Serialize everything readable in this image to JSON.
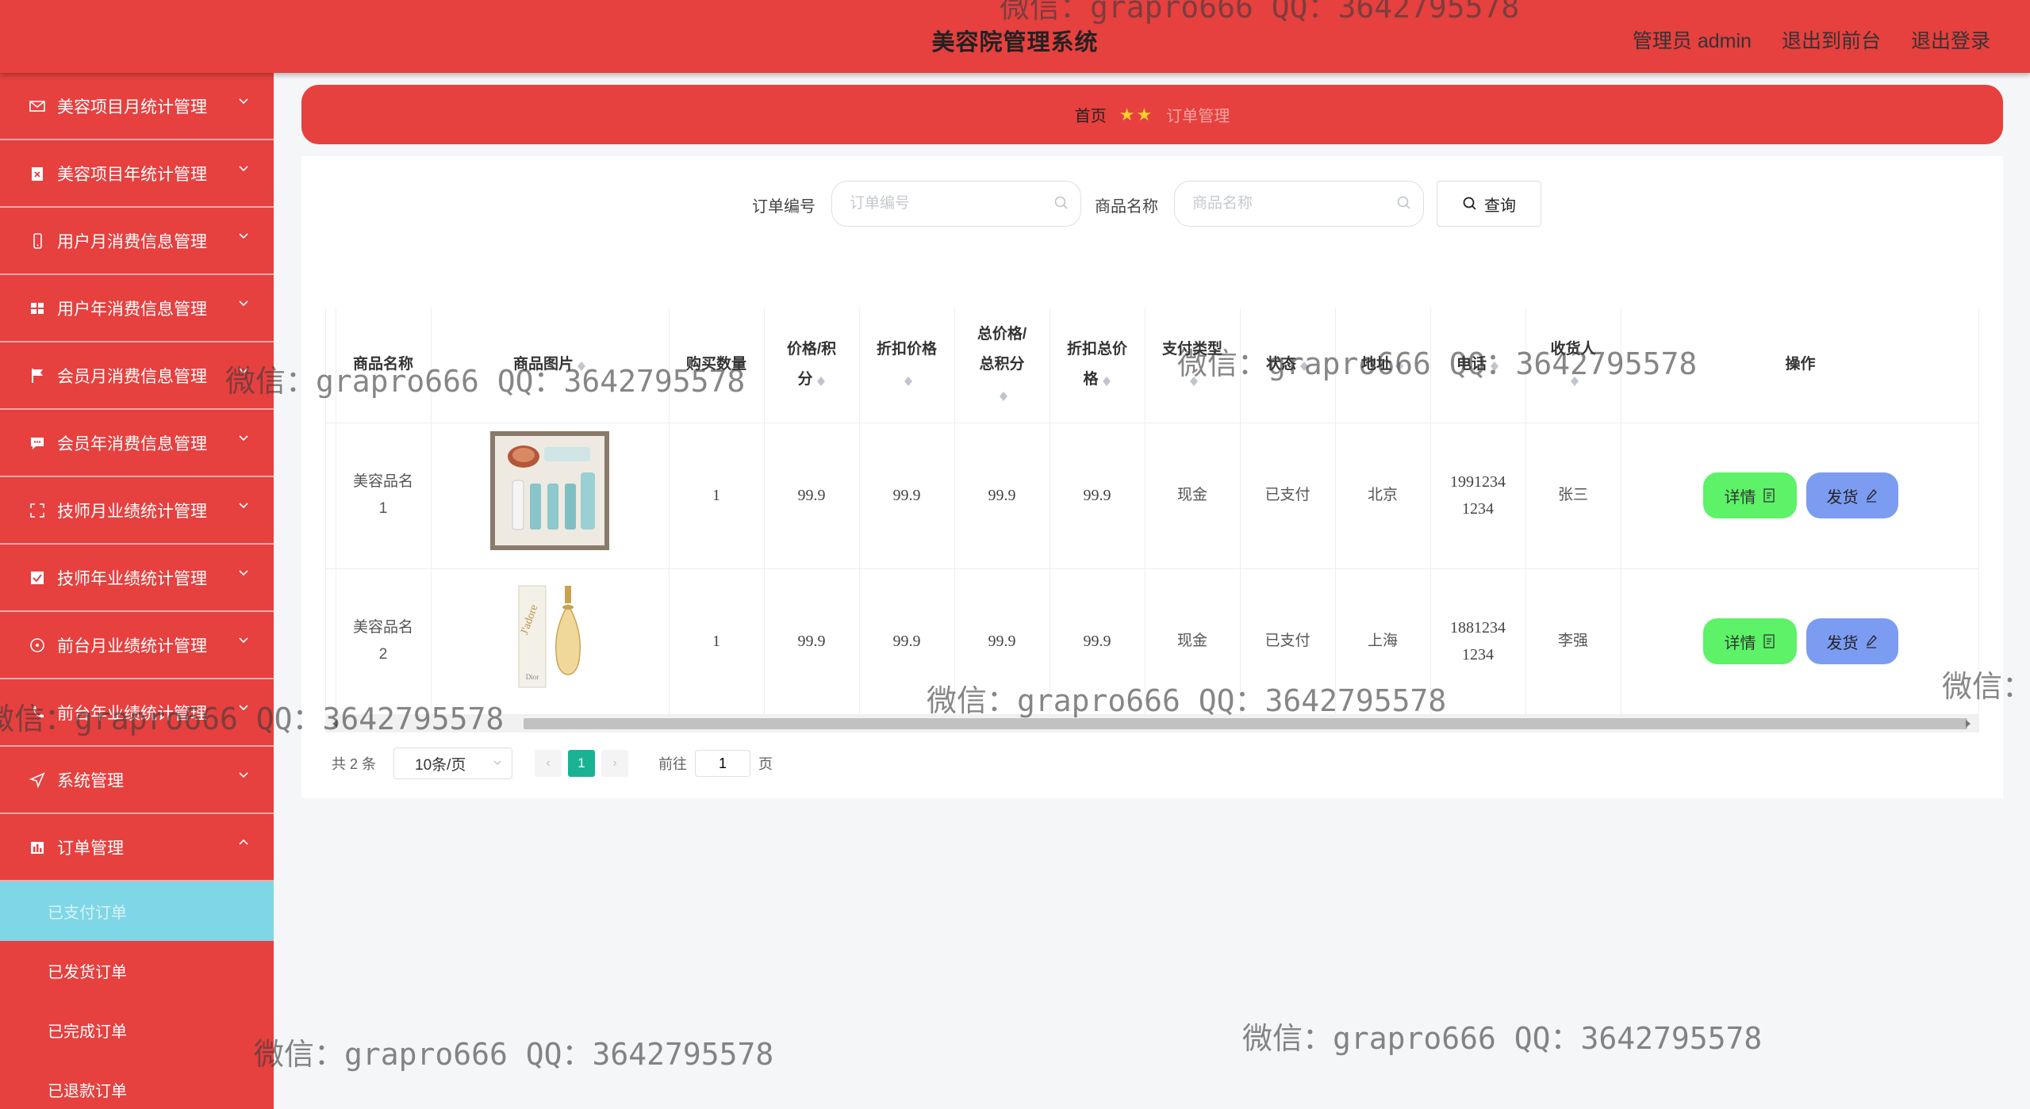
{
  "header": {
    "title": "美容院管理系统",
    "admin": "管理员 admin",
    "to_front": "退出到前台",
    "logout": "退出登录"
  },
  "sidebar": {
    "items": [
      {
        "label": "美容项目月统计管理",
        "icon": "mail-icon"
      },
      {
        "label": "美容项目年统计管理",
        "icon": "document-x-icon"
      },
      {
        "label": "用户月消费信息管理",
        "icon": "mobile-icon"
      },
      {
        "label": "用户年消费信息管理",
        "icon": "grid-icon"
      },
      {
        "label": "会员月消费信息管理",
        "icon": "flag-icon"
      },
      {
        "label": "会员年消费信息管理",
        "icon": "message-icon"
      },
      {
        "label": "技师月业绩统计管理",
        "icon": "fullscreen-icon"
      },
      {
        "label": "技师年业绩统计管理",
        "icon": "checkbox-icon"
      },
      {
        "label": "前台月业绩统计管理",
        "icon": "circle-icon"
      },
      {
        "label": "前台年业绩统计管理",
        "icon": "phone-icon"
      },
      {
        "label": "系统管理",
        "icon": "send-icon"
      },
      {
        "label": "订单管理",
        "icon": "bar-chart-icon"
      }
    ],
    "submenu": [
      "已支付订单",
      "已发货订单",
      "已完成订单",
      "已退款订单"
    ]
  },
  "breadcrumb": {
    "home": "首页",
    "stars": "★★",
    "current": "订单管理"
  },
  "search": {
    "order_label": "订单编号",
    "order_placeholder": "订单编号",
    "product_label": "商品名称",
    "product_placeholder": "商品名称",
    "button": "查询"
  },
  "table": {
    "headers": [
      "商品名称",
      "商品图片",
      "购买数量",
      "价格/积分",
      "折扣价格",
      "总价格/总积分",
      "折扣总价格",
      "支付类型",
      "状态",
      "地址",
      "电话",
      "收货人",
      "操作"
    ],
    "header_lines": {
      "price": [
        "价格/积",
        "分"
      ],
      "total": [
        "总价格/",
        "总积分"
      ],
      "discount_total": [
        "折扣总价",
        "格"
      ]
    },
    "rows": [
      {
        "name": [
          "美容品名",
          "1"
        ],
        "image": "skincare-set-image",
        "qty": "1",
        "price": "99.9",
        "discount": "99.9",
        "total": "99.9",
        "discount_total": "99.9",
        "pay": "现金",
        "status": "已支付",
        "address": "北京",
        "phone": [
          "1991234",
          "1234"
        ],
        "receiver": "张三"
      },
      {
        "name": [
          "美容品名",
          "2"
        ],
        "image": "perfume-image",
        "qty": "1",
        "price": "99.9",
        "discount": "99.9",
        "total": "99.9",
        "discount_total": "99.9",
        "pay": "现金",
        "status": "已支付",
        "address": "上海",
        "phone": [
          "1881234",
          "1234"
        ],
        "receiver": "李强"
      }
    ],
    "detail_btn": "详情",
    "ship_btn": "发货"
  },
  "pagination": {
    "total": "共 2 条",
    "page_size": "10条/页",
    "current_page": "1",
    "goto": "前往",
    "page_value": "1",
    "page_unit": "页"
  },
  "watermark": "微信：grapro666 QQ：3642795578",
  "watermark_partial": "微信：",
  "colors": {
    "primary": "#e6403f",
    "active_sub": "#7fd6e6",
    "detail_btn": "#5df267",
    "ship_btn": "#7c9cf2",
    "page_active": "#19b394"
  }
}
